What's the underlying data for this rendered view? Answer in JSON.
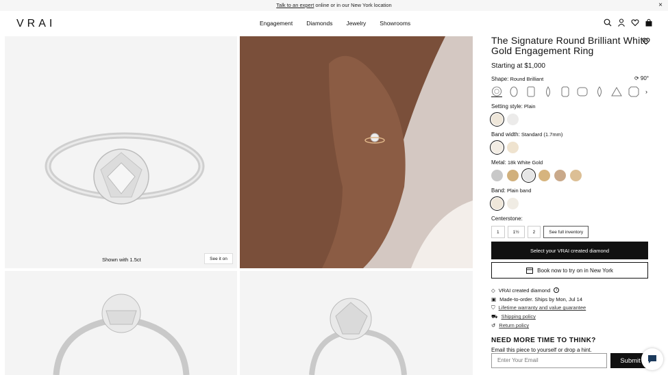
{
  "banner": {
    "link": "Talk to an expert",
    "text": " online or in our New York location",
    "close": "×"
  },
  "logo": "VRAI",
  "nav": [
    "Engagement",
    "Diamonds",
    "Jewelry",
    "Showrooms"
  ],
  "image_panel": {
    "caption": "Shown with 1.5ct",
    "see_it_on": "See it on"
  },
  "product": {
    "title": "The Signature Round Brilliant White Gold Engagement Ring",
    "price": "Starting at $1,000",
    "rotate": "90°",
    "shape_label": "Shape:",
    "shape_value": "Round Brilliant",
    "setting_label": "Setting style:",
    "setting_value": "Plain",
    "bandwidth_label": "Band width:",
    "bandwidth_value": "Standard (1.7mm)",
    "metal_label": "Metal:",
    "metal_value": "18k White Gold",
    "band_label": "Band:",
    "band_value": "Plain band",
    "centerstone_label": "Centerstone:",
    "carats": [
      "1",
      "1½",
      "2"
    ],
    "full_inventory": "See full inventory",
    "select_diamond": "Select your VRAI created diamond",
    "book": "Book now to try on in New York"
  },
  "metal_colors": [
    "#c8c8c8",
    "#d1b07c",
    "#e6e6e6",
    "#d6b47e",
    "#c9a98a",
    "#dcbf95"
  ],
  "info_items": [
    {
      "text": "VRAI created diamond",
      "icon": "diamond-icon"
    },
    {
      "text": "Made-to-order. Ships by Mon, Jul 14",
      "icon": "calendar-icon"
    },
    {
      "text": "Lifetime warranty and value guarantee",
      "icon": "shield-icon"
    },
    {
      "text": "Shipping policy",
      "icon": "truck-icon"
    },
    {
      "text": "Return policy",
      "icon": "return-icon"
    }
  ],
  "hint": {
    "heading": "NEED MORE TIME TO THINK?",
    "sub": "Email this piece to yourself or drop a hint.",
    "placeholder": "Enter Your Email",
    "submit": "Submit"
  }
}
